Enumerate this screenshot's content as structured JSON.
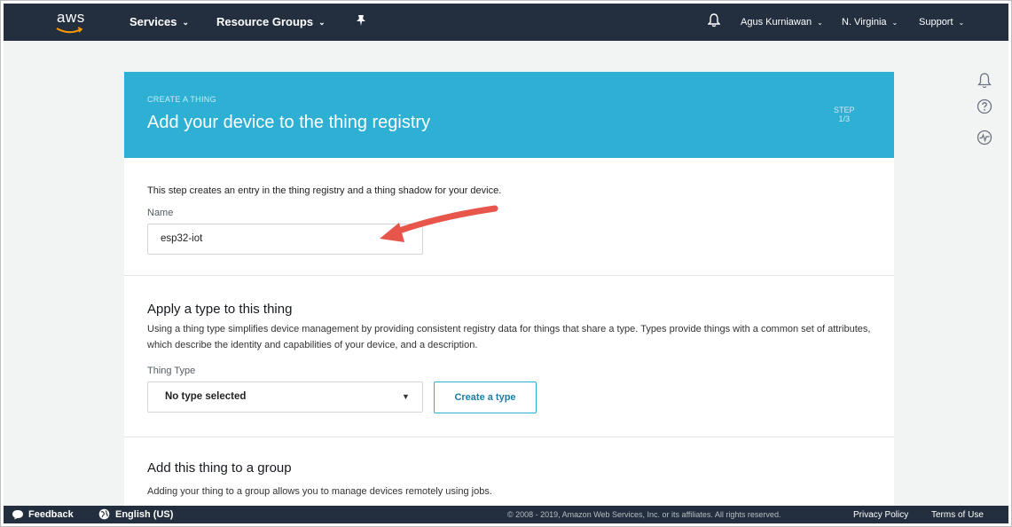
{
  "nav": {
    "logo": "aws",
    "services": "Services",
    "resource_groups": "Resource Groups",
    "user": "Agus Kurniawan",
    "region": "N. Virginia",
    "support": "Support",
    "caret": "⌄"
  },
  "header": {
    "eyebrow": "CREATE A THING",
    "title": "Add your device to the thing registry",
    "step_label": "STEP",
    "step_value": "1/3"
  },
  "registry": {
    "intro": "This step creates an entry in the thing registry and a thing shadow for your device.",
    "name_label": "Name",
    "name_value": "esp32-iot"
  },
  "type_section": {
    "title": "Apply a type to this thing",
    "description": "Using a thing type simplifies device management by providing consistent registry data for things that share a type. Types provide things with a common set of attributes, which describe the identity and capabilities of your device, and a description.",
    "thing_type_label": "Thing Type",
    "selected": "No type selected",
    "create_button": "Create a type"
  },
  "group_section": {
    "title": "Add this thing to a group",
    "description": "Adding your thing to a group allows you to manage devices remotely using jobs."
  },
  "footer": {
    "feedback": "Feedback",
    "language": "English (US)",
    "copyright": "© 2008 - 2019, Amazon Web Services, Inc. or its affiliates. All rights reserved.",
    "privacy": "Privacy Policy",
    "terms": "Terms of Use"
  },
  "colors": {
    "nav_bg": "#232f3e",
    "header_bg": "#2eb0d4",
    "page_bg": "#f2f3f3",
    "annotation_arrow": "#e8554a"
  },
  "icons": [
    "bell-icon",
    "pin-icon",
    "notification-icon",
    "help-icon",
    "activity-icon",
    "feedback-icon",
    "globe-icon",
    "annotation-arrow"
  ]
}
